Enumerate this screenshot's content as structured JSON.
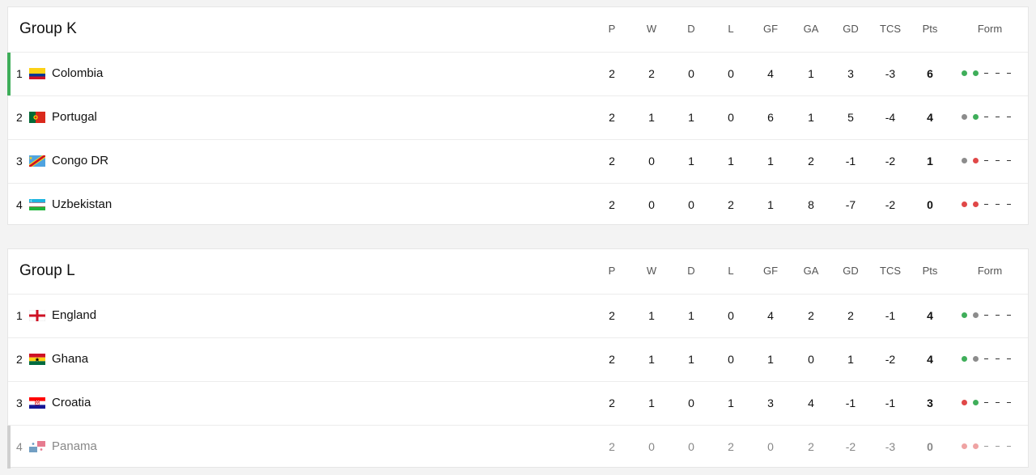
{
  "columns": [
    "P",
    "W",
    "D",
    "L",
    "GF",
    "GA",
    "GD",
    "TCS",
    "Pts",
    "Form"
  ],
  "colors": {
    "win": "#3fae5a",
    "draw": "#8c8c8c",
    "loss": "#e04848",
    "qualified_bar": "#3fae5a",
    "eliminated_bar": "#cfcfcf"
  },
  "groups": [
    {
      "title": "Group K",
      "rows": [
        {
          "pos": "1",
          "team": "Colombia",
          "flag": "colombia-flag",
          "P": "2",
          "W": "2",
          "D": "0",
          "L": "0",
          "GF": "4",
          "GA": "1",
          "GD": "3",
          "TCS": "-3",
          "Pts": "6",
          "form": [
            "W",
            "W",
            "-",
            "-",
            "-"
          ]
        },
        {
          "pos": "2",
          "team": "Portugal",
          "flag": "portugal-flag",
          "P": "2",
          "W": "1",
          "D": "1",
          "L": "0",
          "GF": "6",
          "GA": "1",
          "GD": "5",
          "TCS": "-4",
          "Pts": "4",
          "form": [
            "D",
            "W",
            "-",
            "-",
            "-"
          ]
        },
        {
          "pos": "3",
          "team": "Congo DR",
          "flag": "congo-dr-flag",
          "P": "2",
          "W": "0",
          "D": "1",
          "L": "1",
          "GF": "1",
          "GA": "2",
          "GD": "-1",
          "TCS": "-2",
          "Pts": "1",
          "form": [
            "D",
            "L",
            "-",
            "-",
            "-"
          ]
        },
        {
          "pos": "4",
          "team": "Uzbekistan",
          "flag": "uzbekistan-flag",
          "P": "2",
          "W": "0",
          "D": "0",
          "L": "2",
          "GF": "1",
          "GA": "8",
          "GD": "-7",
          "TCS": "-2",
          "Pts": "0",
          "form": [
            "L",
            "L",
            "-",
            "-",
            "-"
          ]
        }
      ]
    },
    {
      "title": "Group L",
      "rows": [
        {
          "pos": "1",
          "team": "England",
          "flag": "england-flag",
          "P": "2",
          "W": "1",
          "D": "1",
          "L": "0",
          "GF": "4",
          "GA": "2",
          "GD": "2",
          "TCS": "-1",
          "Pts": "4",
          "form": [
            "W",
            "D",
            "-",
            "-",
            "-"
          ]
        },
        {
          "pos": "2",
          "team": "Ghana",
          "flag": "ghana-flag",
          "P": "2",
          "W": "1",
          "D": "1",
          "L": "0",
          "GF": "1",
          "GA": "0",
          "GD": "1",
          "TCS": "-2",
          "Pts": "4",
          "form": [
            "W",
            "D",
            "-",
            "-",
            "-"
          ]
        },
        {
          "pos": "3",
          "team": "Croatia",
          "flag": "croatia-flag",
          "P": "2",
          "W": "1",
          "D": "0",
          "L": "1",
          "GF": "3",
          "GA": "4",
          "GD": "-1",
          "TCS": "-1",
          "Pts": "3",
          "form": [
            "L",
            "W",
            "-",
            "-",
            "-"
          ]
        },
        {
          "pos": "4",
          "team": "Panama",
          "flag": "panama-flag",
          "P": "2",
          "W": "0",
          "D": "0",
          "L": "2",
          "GF": "0",
          "GA": "2",
          "GD": "-2",
          "TCS": "-3",
          "Pts": "0",
          "form": [
            "L",
            "L",
            "-",
            "-",
            "-"
          ]
        }
      ]
    }
  ]
}
